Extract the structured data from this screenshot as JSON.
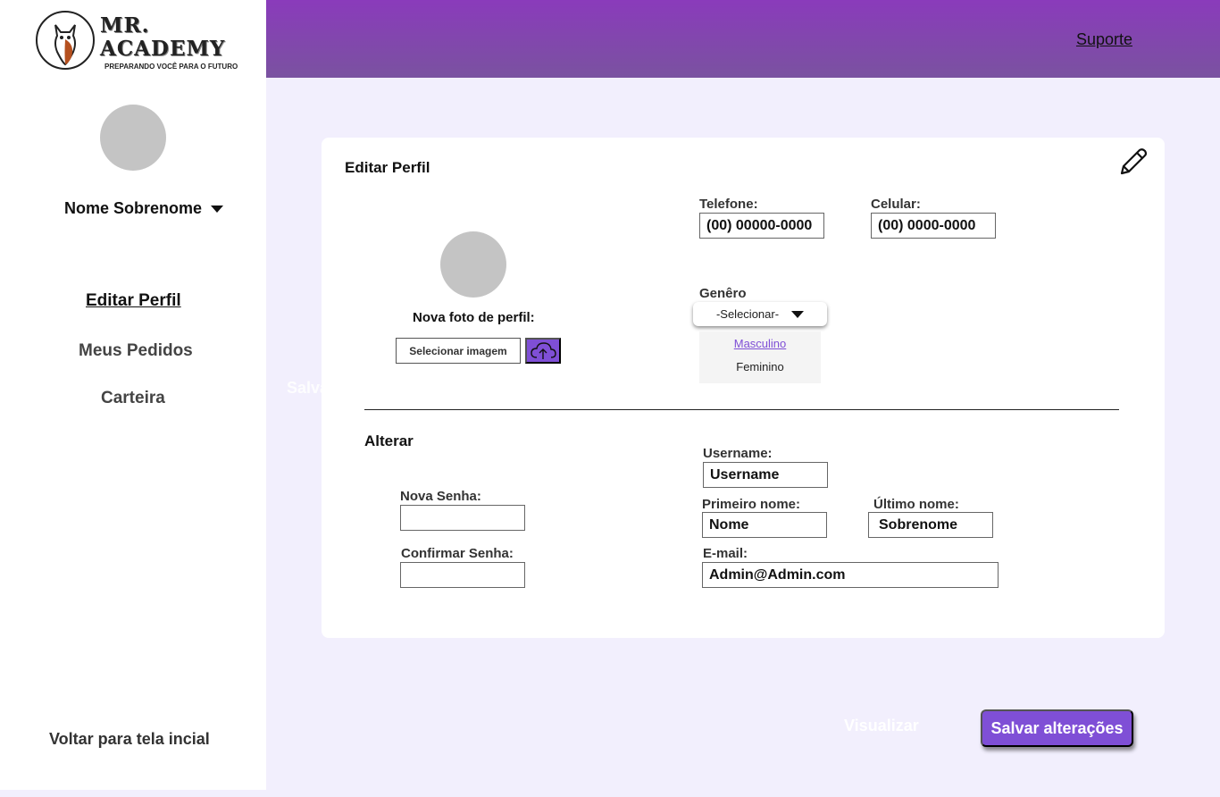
{
  "brand": {
    "title_line1": "MR.",
    "title_line2": "ACADEMY",
    "tagline": "PREPARANDO VOCÊ PARA O FUTURO"
  },
  "header": {
    "support_label": "Suporte"
  },
  "sidebar": {
    "user_name": "Nome Sobrenome",
    "nav": [
      {
        "label": "Editar Perfil",
        "active": true
      },
      {
        "label": "Meus Pedidos",
        "active": false
      },
      {
        "label": "Carteira",
        "active": false
      }
    ],
    "back_label": "Voltar para tela incial"
  },
  "ghost_text": "Salvar alterações",
  "profile": {
    "title": "Editar Perfil",
    "photo_label": "Nova foto de perfil:",
    "select_image_label": "Selecionar imagem",
    "phone": {
      "label": "Telefone:",
      "value": "(00) 00000-0000"
    },
    "mobile": {
      "label": "Celular:",
      "value": "(00) 0000-0000"
    },
    "gender": {
      "label": "Genêro",
      "selected": "-Selecionar-",
      "options": [
        "Masculino",
        "Feminino"
      ]
    }
  },
  "change": {
    "title": "Alterar",
    "new_password": {
      "label": "Nova Senha:",
      "value": ""
    },
    "confirm_password": {
      "label": "Confirmar Senha:",
      "value": ""
    },
    "username": {
      "label": "Username:",
      "value": "Username"
    },
    "first_name": {
      "label": "Primeiro nome:",
      "value": "Nome"
    },
    "last_name": {
      "label": "Último nome:",
      "value": "Sobrenome"
    },
    "email": {
      "label": "E-mail:",
      "value": "Admin@Admin.com"
    }
  },
  "actions": {
    "visualize_label": "Visualizar",
    "save_label": "Salvar alterações"
  },
  "colors": {
    "accent": "#7f4fd6",
    "header": "#8a3bbb",
    "background": "#f2effd"
  }
}
